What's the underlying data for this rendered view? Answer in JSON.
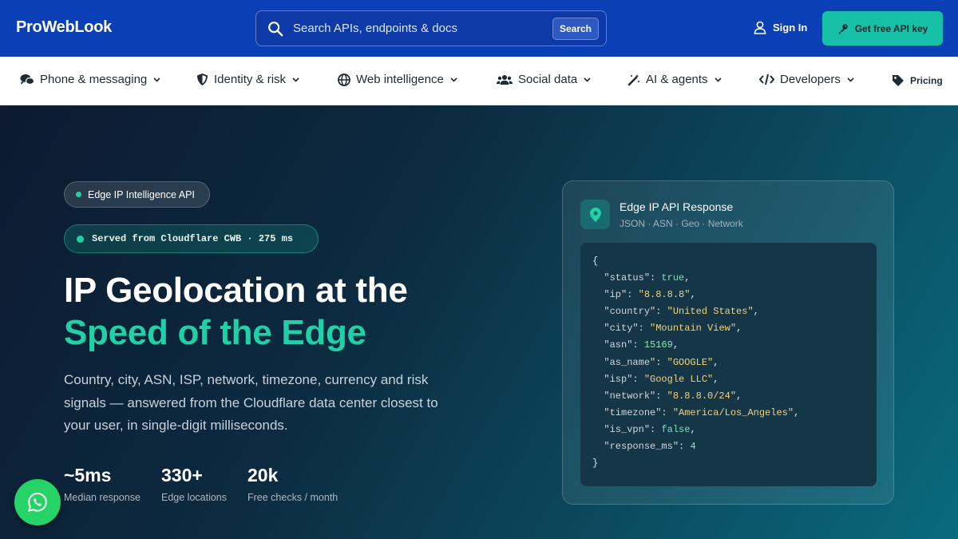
{
  "header": {
    "logo": "ProWebLook",
    "search_placeholder": "Search APIs, endpoints & docs",
    "search_button": "Search",
    "sign_in": "Sign In",
    "cta": "Get free API key"
  },
  "nav": [
    {
      "label": "Phone & messaging",
      "icon": "chat-icon"
    },
    {
      "label": "Identity & risk",
      "icon": "shield-icon"
    },
    {
      "label": "Web intelligence",
      "icon": "globe-icon"
    },
    {
      "label": "Social data",
      "icon": "users-icon"
    },
    {
      "label": "AI & agents",
      "icon": "magic-wand-icon"
    },
    {
      "label": "Developers",
      "icon": "code-icon"
    },
    {
      "label": "Pricing",
      "icon": "tag-icon"
    }
  ],
  "hero": {
    "badge": "Edge IP Intelligence API",
    "served": "Served from Cloudflare CWB · 275 ms",
    "title_line1": "IP Geolocation at the",
    "title_line2": "Speed of the Edge",
    "description": "Country, city, ASN, ISP, network, timezone, currency and risk signals — answered from the Cloudflare data center closest to your user, in single-digit milliseconds.",
    "stats": [
      {
        "value": "~5ms",
        "label": "Median response"
      },
      {
        "value": "330+",
        "label": "Edge locations"
      },
      {
        "value": "20k",
        "label": "Free checks / month"
      }
    ]
  },
  "card": {
    "title": "Edge IP API Response",
    "subtitle": "JSON · ASN · Geo · Network",
    "icon": "location-pin-icon",
    "code_open": "{",
    "code_close": "}",
    "fields": [
      {
        "key": "\"status\"",
        "value": "true",
        "type": "b",
        "comma": ","
      },
      {
        "key": "\"ip\"",
        "value": "\"8.8.8.8\"",
        "type": "s",
        "comma": ","
      },
      {
        "key": "\"country\"",
        "value": "\"United States\"",
        "type": "s",
        "comma": ","
      },
      {
        "key": "\"city\"",
        "value": "\"Mountain View\"",
        "type": "s",
        "comma": ","
      },
      {
        "key": "\"asn\"",
        "value": "15169",
        "type": "n",
        "comma": ","
      },
      {
        "key": "\"as_name\"",
        "value": "\"GOOGLE\"",
        "type": "s",
        "comma": ","
      },
      {
        "key": "\"isp\"",
        "value": "\"Google LLC\"",
        "type": "s",
        "comma": ","
      },
      {
        "key": "\"network\"",
        "value": "\"8.8.8.0/24\"",
        "type": "s",
        "comma": ","
      },
      {
        "key": "\"timezone\"",
        "value": "\"America/Los_Angeles\"",
        "type": "s",
        "comma": ","
      },
      {
        "key": "\"is_vpn\"",
        "value": "false",
        "type": "b",
        "comma": ","
      },
      {
        "key": "\"response_ms\"",
        "value": "4",
        "type": "n",
        "comma": ""
      }
    ]
  },
  "floating": {
    "icon": "whatsapp-icon"
  },
  "colors": {
    "header": "#0a3fb6",
    "accent": "#1fd1a6",
    "cta": "#15c0a6"
  }
}
